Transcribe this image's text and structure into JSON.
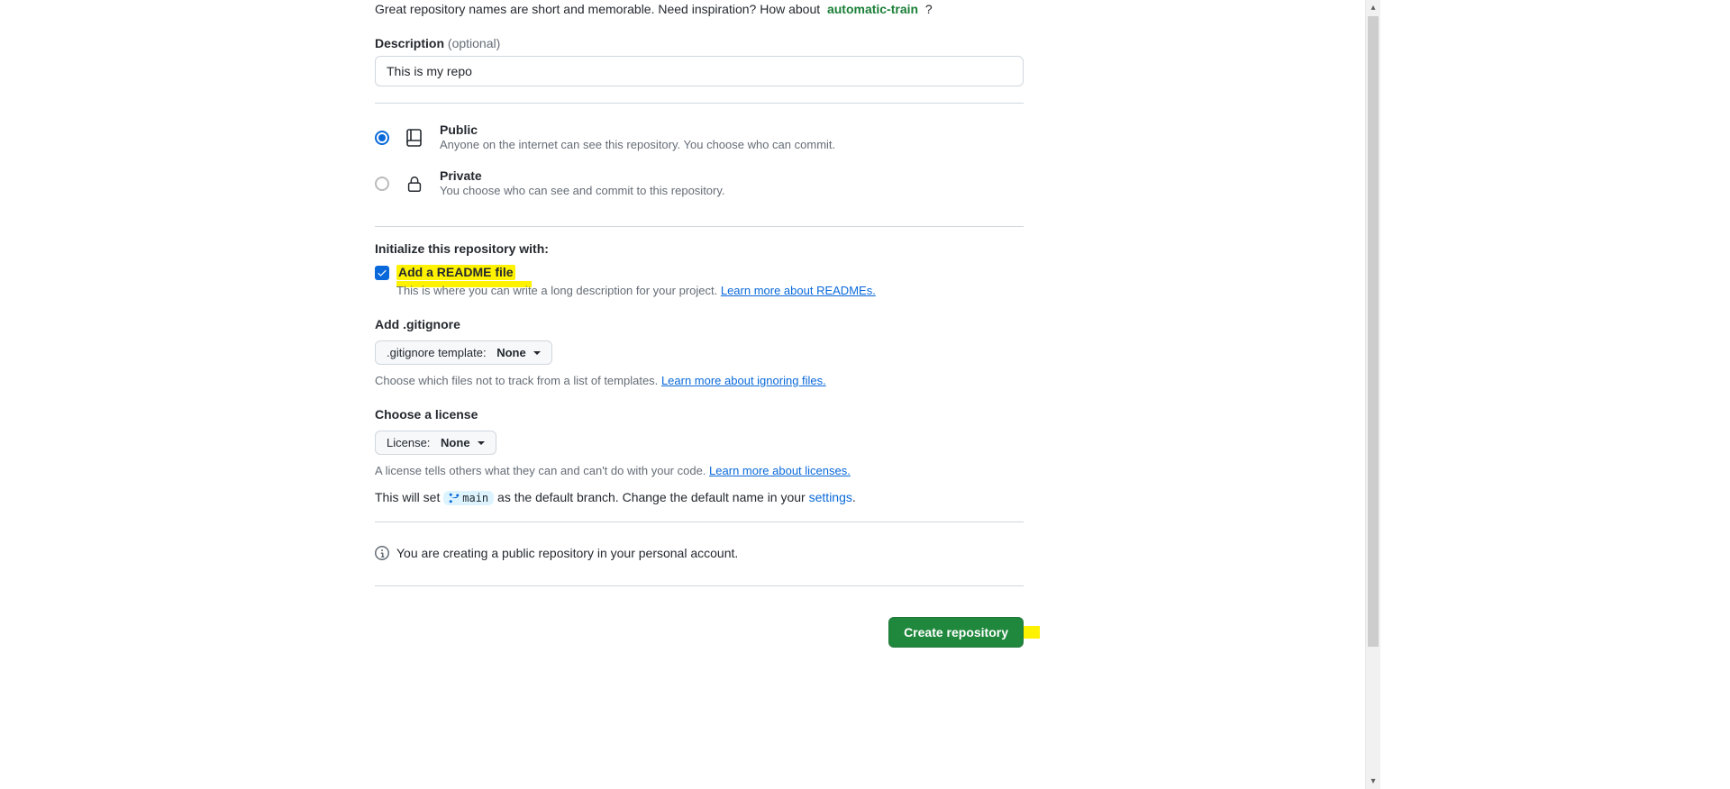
{
  "tagline": {
    "prefix": "Great repository names are short and memorable. Need inspiration? How about",
    "suggestion": "automatic-train",
    "suffix": "?"
  },
  "description": {
    "label": "Description",
    "optional": "(optional)",
    "value": "This is my repo"
  },
  "visibility": {
    "public": {
      "title": "Public",
      "desc": "Anyone on the internet can see this repository. You choose who can commit."
    },
    "private": {
      "title": "Private",
      "desc": "You choose who can see and commit to this repository."
    }
  },
  "init": {
    "heading": "Initialize this repository with:",
    "readme_label": "Add a README file",
    "readme_desc": "This is where you can write a long description for your project.",
    "readme_link": "Learn more about READMEs."
  },
  "gitignore": {
    "heading": "Add .gitignore",
    "prefix": ".gitignore template:",
    "value": "None",
    "help": "Choose which files not to track from a list of templates.",
    "link": "Learn more about ignoring files."
  },
  "license": {
    "heading": "Choose a license",
    "prefix": "License:",
    "value": "None",
    "help": "A license tells others what they can and can't do with your code.",
    "link": "Learn more about licenses."
  },
  "branch": {
    "pre": "This will set",
    "name": "main",
    "mid": "as the default branch. Change the default name in your",
    "settings": "settings",
    "dot": "."
  },
  "info_line": "You are creating a public repository in your personal account.",
  "create_button": "Create repository"
}
